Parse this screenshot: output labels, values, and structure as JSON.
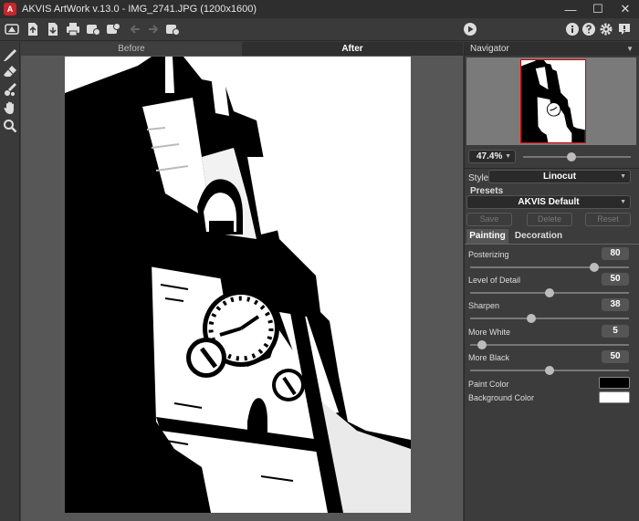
{
  "window": {
    "title": "AKVIS ArtWork v.13.0 - IMG_2741.JPG (1200x1600)",
    "logo": "A",
    "minimize": "—",
    "maximize": "☐",
    "close": "✕"
  },
  "toolbar": {
    "left_icons": [
      "home-icon",
      "open-icon",
      "save-icon",
      "print-icon",
      "settings-batch-icon",
      "plugin-icon",
      "undo-icon",
      "redo-icon",
      "process-settings-icon"
    ],
    "right_icons": [
      "run-icon",
      "info-icon",
      "help-icon",
      "gear-icon",
      "feedback-icon"
    ]
  },
  "tools": [
    "brush-icon",
    "eraser-icon",
    "stroke-brush-icon",
    "hand-icon",
    "zoom-icon"
  ],
  "tabs": [
    {
      "label": "Before",
      "active": false
    },
    {
      "label": "After",
      "active": true
    }
  ],
  "navigator": {
    "title": "Navigator",
    "zoom": "47.4%"
  },
  "settings": {
    "style_label": "Style:",
    "style_value": "Linocut",
    "presets_title": "Presets",
    "preset_value": "AKVIS Default",
    "buttons": {
      "save": "Save",
      "delete": "Delete",
      "reset": "Reset"
    },
    "subtabs": [
      {
        "label": "Painting",
        "active": true
      },
      {
        "label": "Decoration",
        "active": false
      }
    ],
    "params": [
      {
        "label": "Posterizing",
        "value": "80",
        "fraction": 0.8
      },
      {
        "label": "Level of Detail",
        "value": "50",
        "fraction": 0.5
      },
      {
        "label": "Sharpen",
        "value": "38",
        "fraction": 0.38
      },
      {
        "label": "More White",
        "value": "5",
        "fraction": 0.05
      },
      {
        "label": "More Black",
        "value": "50",
        "fraction": 0.5
      }
    ],
    "paint_color_label": "Paint Color",
    "paint_color": "#000000",
    "background_color_label": "Background Color",
    "background_color": "#ffffff"
  }
}
